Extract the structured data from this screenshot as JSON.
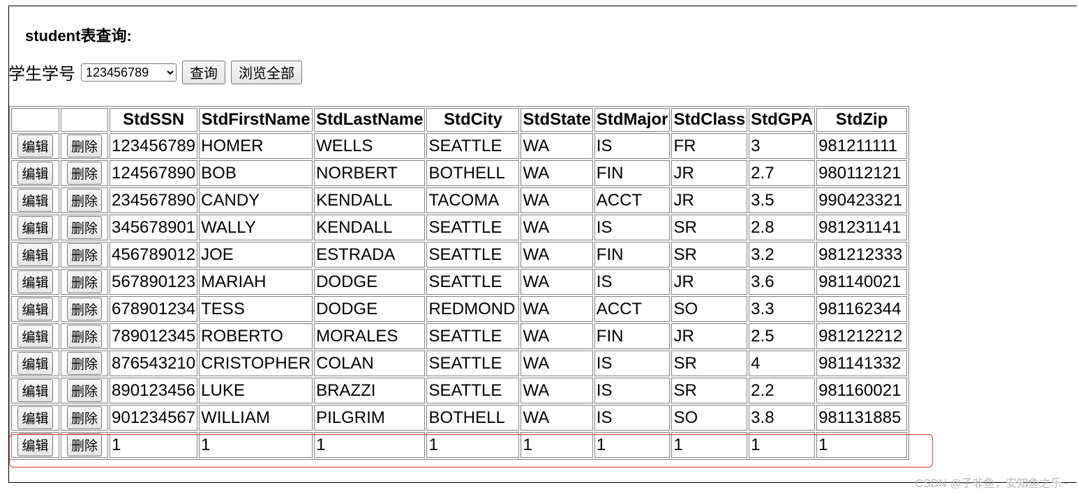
{
  "page": {
    "title": "student表查询:"
  },
  "query": {
    "label": "学生学号",
    "selected_ssn": "123456789",
    "query_button": "查询",
    "browse_all_button": "浏览全部"
  },
  "table": {
    "columns": [
      "",
      "",
      "StdSSN",
      "StdFirstName",
      "StdLastName",
      "StdCity",
      "StdState",
      "StdMajor",
      "StdClass",
      "StdGPA",
      "StdZip"
    ],
    "edit_label": "编辑",
    "delete_label": "删除",
    "rows": [
      [
        "123456789",
        "HOMER",
        "WELLS",
        "SEATTLE",
        "WA",
        "IS",
        "FR",
        "3",
        "981211111"
      ],
      [
        "124567890",
        "BOB",
        "NORBERT",
        "BOTHELL",
        "WA",
        "FIN",
        "JR",
        "2.7",
        "980112121"
      ],
      [
        "234567890",
        "CANDY",
        "KENDALL",
        "TACOMA",
        "WA",
        "ACCT",
        "JR",
        "3.5",
        "990423321"
      ],
      [
        "345678901",
        "WALLY",
        "KENDALL",
        "SEATTLE",
        "WA",
        "IS",
        "SR",
        "2.8",
        "981231141"
      ],
      [
        "456789012",
        "JOE",
        "ESTRADA",
        "SEATTLE",
        "WA",
        "FIN",
        "SR",
        "3.2",
        "981212333"
      ],
      [
        "567890123",
        "MARIAH",
        "DODGE",
        "SEATTLE",
        "WA",
        "IS",
        "JR",
        "3.6",
        "981140021"
      ],
      [
        "678901234",
        "TESS",
        "DODGE",
        "REDMOND",
        "WA",
        "ACCT",
        "SO",
        "3.3",
        "981162344"
      ],
      [
        "789012345",
        "ROBERTO",
        "MORALES",
        "SEATTLE",
        "WA",
        "FIN",
        "JR",
        "2.5",
        "981212212"
      ],
      [
        "876543210",
        "CRISTOPHER",
        "COLAN",
        "SEATTLE",
        "WA",
        "IS",
        "SR",
        "4",
        "981141332"
      ],
      [
        "890123456",
        "LUKE",
        "BRAZZI",
        "SEATTLE",
        "WA",
        "IS",
        "SR",
        "2.2",
        "981160021"
      ],
      [
        "901234567",
        "WILLIAM",
        "PILGRIM",
        "BOTHELL",
        "WA",
        "IS",
        "SO",
        "3.8",
        "981131885"
      ],
      [
        "1",
        "1",
        "1",
        "1",
        "1",
        "1",
        "1",
        "1",
        "1"
      ]
    ]
  },
  "watermark": "CSDN @子非鱼，安知鱼之乐~",
  "colors": {
    "highlight": "#e53935"
  }
}
